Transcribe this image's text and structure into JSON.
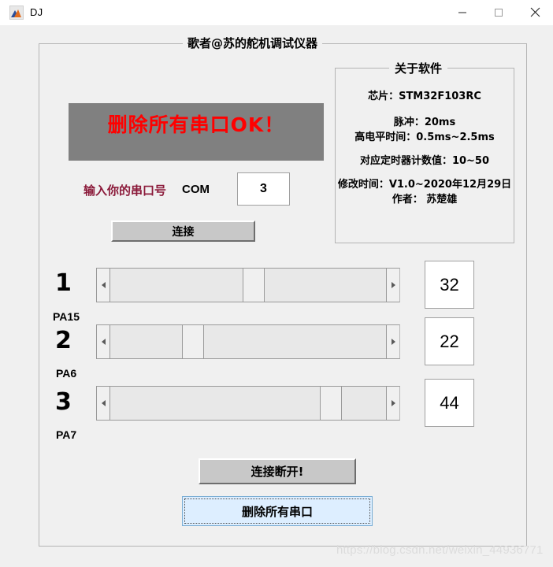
{
  "window": {
    "title": "DJ",
    "icon": "matlab-app-icon",
    "controls": {
      "minimize": "minimize-icon",
      "maximize": "maximize-icon",
      "close": "close-icon"
    }
  },
  "main_panel": {
    "title": "歌者@苏的舵机调试仪器"
  },
  "status": {
    "text": "删除所有串口OK！",
    "text_color": "#ff0000",
    "background_color": "#808080"
  },
  "com": {
    "label": "输入你的串口号",
    "label_color": "#8b1a3a",
    "prefix": "COM",
    "value": "3"
  },
  "buttons": {
    "connect": "连接",
    "disconnect": "连接断开!",
    "delete_ports": "删除所有串口"
  },
  "about": {
    "title": "关于软件",
    "lines": [
      "芯片：STM32F103RC",
      "脉冲：20ms",
      "高电平时间：0.5ms~2.5ms",
      "对应定时器计数值：10~50",
      "修改时间：V1.0~2020年12月29日",
      "作者： 苏楚雄"
    ]
  },
  "sliders": [
    {
      "index": "1",
      "pin": "PA15",
      "value": "32",
      "thumb_percent": 52,
      "min": 10,
      "max": 50
    },
    {
      "index": "2",
      "pin": "PA6",
      "value": "22",
      "thumb_percent": 30,
      "min": 10,
      "max": 50
    },
    {
      "index": "3",
      "pin": "PA7",
      "value": "44",
      "thumb_percent": 80,
      "min": 10,
      "max": 50
    }
  ],
  "watermark": {
    "text": "https://blog.csdn.net/weixin_44936771"
  }
}
